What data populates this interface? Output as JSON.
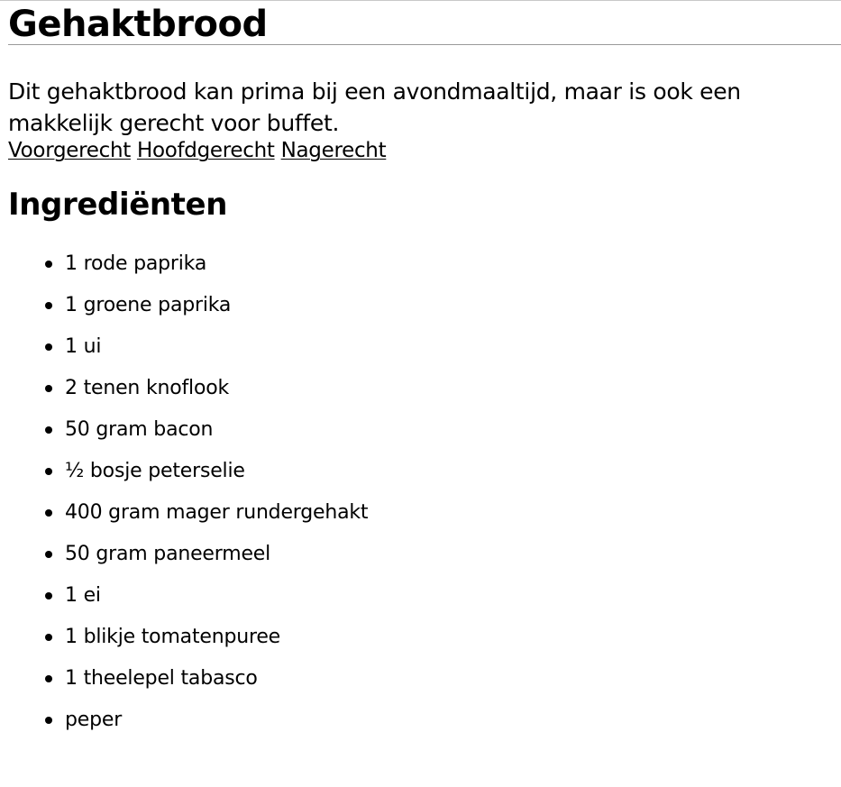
{
  "recipe": {
    "title": "Gehaktbrood",
    "intro": "Dit gehaktbrood kan prima bij een avondmaaltijd, maar is ook een makkelijk gerecht voor buffet.",
    "categories": [
      "Voorgerecht",
      "Hoofdgerecht",
      "Nagerecht"
    ],
    "ingredients_heading": "Ingrediënten",
    "ingredients": [
      "1 rode paprika",
      "1 groene paprika",
      "1 ui",
      "2 tenen knoflook",
      "50 gram bacon",
      "½ bosje peterselie",
      "400 gram mager rundergehakt",
      "50 gram paneermeel",
      "1 ei",
      "1 blikje tomatenpuree",
      "1 theelepel tabasco",
      "peper"
    ]
  }
}
